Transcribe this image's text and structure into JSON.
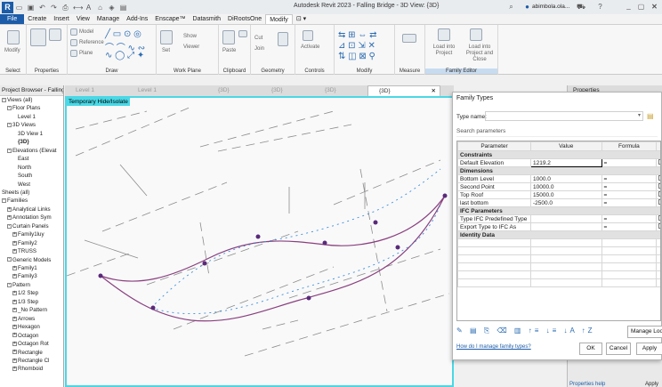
{
  "window": {
    "title": "Autodesk Revit 2023 - Falling Bridge - 3D View: {3D}",
    "user": "abimbola.ola...",
    "app_logo": "R"
  },
  "menu": {
    "file": "File",
    "tabs": [
      "Create",
      "Insert",
      "View",
      "Manage",
      "Add-Ins",
      "Enscape™",
      "Datasmith",
      "DiRootsOne",
      "Modify"
    ],
    "active_index": 8
  },
  "ribbon": {
    "groups": [
      "Select",
      "Properties",
      "Draw",
      "Work Plane",
      "Clipboard",
      "Geometry",
      "Controls",
      "Modify",
      "Measure",
      "Family Editor"
    ],
    "modify_label": "Modify",
    "draw_labels": [
      "Model",
      "Reference",
      "Plane"
    ],
    "work_plane_labels": [
      "Set",
      "Show",
      "Viewer"
    ],
    "clipboard_labels": [
      "Paste"
    ],
    "geometry_labels": [
      "Cut",
      "Join"
    ],
    "controls_labels": [
      "Activate"
    ],
    "family_editor_labels": [
      "Load into Project",
      "Load into Project and Close"
    ]
  },
  "project_browser": {
    "title": "Project Browser - Falling...",
    "items": [
      {
        "label": "Views (all)",
        "indent": 0,
        "toggle": "-"
      },
      {
        "label": "Floor Plans",
        "indent": 1,
        "toggle": "-"
      },
      {
        "label": "Level 1",
        "indent": 3,
        "toggle": ""
      },
      {
        "label": "3D Views",
        "indent": 1,
        "toggle": "-"
      },
      {
        "label": "3D View 1",
        "indent": 3,
        "toggle": ""
      },
      {
        "label": "{3D}",
        "indent": 3,
        "toggle": "",
        "bold": true
      },
      {
        "label": "Elevations (Elevat",
        "indent": 1,
        "toggle": "-"
      },
      {
        "label": "East",
        "indent": 3,
        "toggle": ""
      },
      {
        "label": "North",
        "indent": 3,
        "toggle": ""
      },
      {
        "label": "South",
        "indent": 3,
        "toggle": ""
      },
      {
        "label": "West",
        "indent": 3,
        "toggle": ""
      },
      {
        "label": "Sheets (all)",
        "indent": 0,
        "toggle": ""
      },
      {
        "label": "Families",
        "indent": 0,
        "toggle": "-"
      },
      {
        "label": "Analytical Links",
        "indent": 1,
        "toggle": "+"
      },
      {
        "label": "Annotation Sym",
        "indent": 1,
        "toggle": "+"
      },
      {
        "label": "Curtain Panels",
        "indent": 1,
        "toggle": "-"
      },
      {
        "label": "Family1luy",
        "indent": 2,
        "toggle": "+"
      },
      {
        "label": "Family2",
        "indent": 2,
        "toggle": "+"
      },
      {
        "label": "TRUSS",
        "indent": 2,
        "toggle": "+"
      },
      {
        "label": "Generic Models",
        "indent": 1,
        "toggle": "-"
      },
      {
        "label": "Family1",
        "indent": 2,
        "toggle": "+"
      },
      {
        "label": "Family3",
        "indent": 2,
        "toggle": "+"
      },
      {
        "label": "Pattern",
        "indent": 1,
        "toggle": "-"
      },
      {
        "label": "1/2 Step",
        "indent": 2,
        "toggle": "+"
      },
      {
        "label": "1/3 Step",
        "indent": 2,
        "toggle": "+"
      },
      {
        "label": "_No Pattern",
        "indent": 2,
        "toggle": "+"
      },
      {
        "label": "Arrows",
        "indent": 2,
        "toggle": "+"
      },
      {
        "label": "Hexagon",
        "indent": 2,
        "toggle": "+"
      },
      {
        "label": "Octagon",
        "indent": 2,
        "toggle": "+"
      },
      {
        "label": "Octagon Rot",
        "indent": 2,
        "toggle": "+"
      },
      {
        "label": "Rectangle",
        "indent": 2,
        "toggle": "+"
      },
      {
        "label": "Rectangle Cl",
        "indent": 2,
        "toggle": "+"
      },
      {
        "label": "Rhomboid",
        "indent": 2,
        "toggle": "+"
      }
    ]
  },
  "view_tabs": [
    "Level 1",
    "Level 1",
    "{3D}",
    "{3D}",
    "{3D}",
    "{3D}"
  ],
  "active_view_tab": 5,
  "viewport": {
    "temp_label": "Temporary Hide/Isolate",
    "border_color": "#4ad8e6"
  },
  "dialog": {
    "title": "Family Types",
    "type_name_label": "Type name:",
    "search_placeholder": "Search parameters",
    "columns": [
      "Parameter",
      "Value",
      "Formula",
      "L"
    ],
    "rows": [
      {
        "category": "Constraints"
      },
      {
        "name": "Default Elevation",
        "value": "1219.2",
        "formula": "="
      },
      {
        "category": "Dimensions"
      },
      {
        "name": "Bottom Level",
        "value": "1000.0",
        "formula": "="
      },
      {
        "name": "Second Point",
        "value": "10000.0",
        "formula": "="
      },
      {
        "name": "Top Roof",
        "value": "15000.0",
        "formula": "="
      },
      {
        "name": "last bottom",
        "value": "-2500.0",
        "formula": "="
      },
      {
        "category": "IFC Parameters"
      },
      {
        "name": "Type IFC Predefined Type",
        "value": "",
        "formula": "="
      },
      {
        "name": "Export Type to IFC As",
        "value": "",
        "formula": "="
      },
      {
        "category": "Identity Data"
      }
    ],
    "help_link": "How do I manage family types?",
    "manage_lookup": "Manage Lookup Ta",
    "ok": "OK",
    "cancel": "Cancel",
    "apply": "Apply"
  },
  "right_panel": {
    "title": "Properties",
    "help": "Properties help",
    "apply": "Apply"
  },
  "colors": {
    "accent": "#1c5ca8",
    "highlight": "#4ad8e6",
    "curve": "#8a3f7e",
    "point": "#3b8fd6",
    "node": "#5a2a7a"
  }
}
